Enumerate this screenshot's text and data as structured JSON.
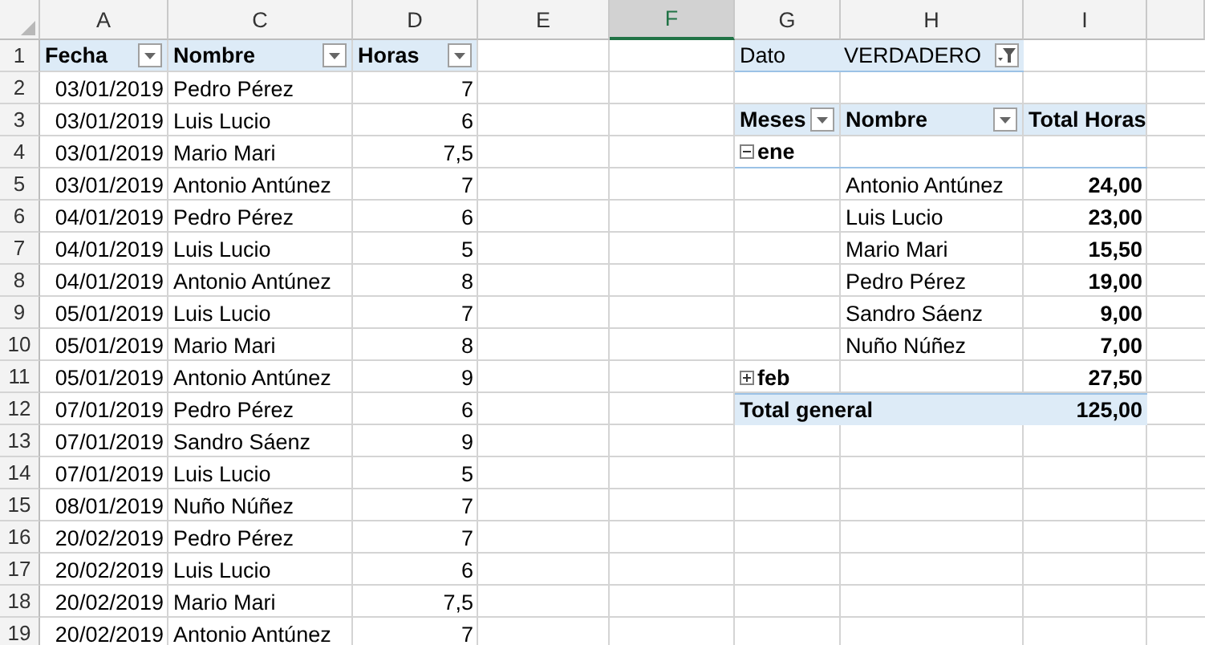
{
  "column_headers": [
    {
      "label": "A",
      "selected": false
    },
    {
      "label": "C",
      "selected": false
    },
    {
      "label": "D",
      "selected": false
    },
    {
      "label": "E",
      "selected": false
    },
    {
      "label": "F",
      "selected": true
    },
    {
      "label": "G",
      "selected": false
    },
    {
      "label": "H",
      "selected": false
    },
    {
      "label": "I",
      "selected": false
    }
  ],
  "row_numbers": [
    "1",
    "2",
    "3",
    "4",
    "5",
    "6",
    "7",
    "8",
    "9",
    "10",
    "11",
    "12",
    "13",
    "14",
    "15",
    "16",
    "17",
    "18",
    "19"
  ],
  "source_table": {
    "headers": [
      "Fecha",
      "Nombre",
      "Horas"
    ],
    "rows": [
      [
        "03/01/2019",
        "Pedro Pérez",
        "7"
      ],
      [
        "03/01/2019",
        "Luis Lucio",
        "6"
      ],
      [
        "03/01/2019",
        "Mario Mari",
        "7,5"
      ],
      [
        "03/01/2019",
        "Antonio Antúnez",
        "7"
      ],
      [
        "04/01/2019",
        "Pedro Pérez",
        "6"
      ],
      [
        "04/01/2019",
        "Luis Lucio",
        "5"
      ],
      [
        "04/01/2019",
        "Antonio Antúnez",
        "8"
      ],
      [
        "05/01/2019",
        "Luis Lucio",
        "7"
      ],
      [
        "05/01/2019",
        "Mario Mari",
        "8"
      ],
      [
        "05/01/2019",
        "Antonio Antúnez",
        "9"
      ],
      [
        "07/01/2019",
        "Pedro Pérez",
        "6"
      ],
      [
        "07/01/2019",
        "Sandro Sáenz",
        "9"
      ],
      [
        "07/01/2019",
        "Luis Lucio",
        "5"
      ],
      [
        "08/01/2019",
        "Nuño Núñez",
        "7"
      ],
      [
        "20/02/2019",
        "Pedro Pérez",
        "7"
      ],
      [
        "20/02/2019",
        "Luis Lucio",
        "6"
      ],
      [
        "20/02/2019",
        "Mario Mari",
        "7,5"
      ],
      [
        "20/02/2019",
        "Antonio Antúnez",
        "7"
      ]
    ]
  },
  "pivot_table": {
    "filter": {
      "label": "Dato",
      "value": "VERDADERO"
    },
    "headers": [
      "Meses",
      "Nombre",
      "Total Horas"
    ],
    "groups": [
      {
        "label": "ene",
        "expanded": true,
        "items": [
          {
            "name": "Antonio Antúnez",
            "total": "24,00"
          },
          {
            "name": "Luis Lucio",
            "total": "23,00"
          },
          {
            "name": "Mario Mari",
            "total": "15,50"
          },
          {
            "name": "Pedro Pérez",
            "total": "19,00"
          },
          {
            "name": "Sandro Sáenz",
            "total": "9,00"
          },
          {
            "name": "Nuño Núñez",
            "total": "7,00"
          }
        ]
      },
      {
        "label": "feb",
        "expanded": false,
        "total": "27,50"
      }
    ],
    "grand_total": {
      "label": "Total general",
      "value": "125,00"
    }
  }
}
